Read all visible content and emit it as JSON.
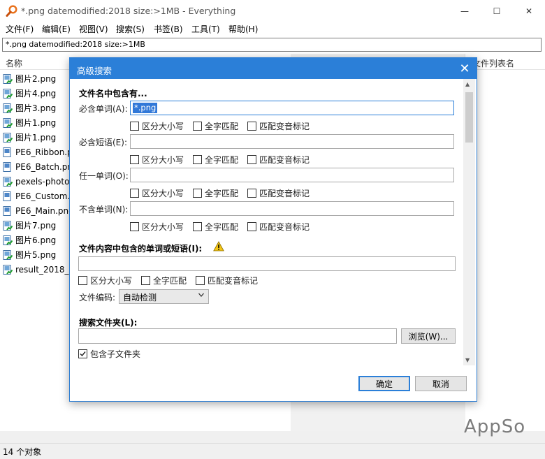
{
  "window": {
    "title": "*.png datemodified:2018 size:>1MB - Everything",
    "minimize_glyph": "—",
    "maximize_glyph": "☐",
    "close_glyph": "✕"
  },
  "menu": [
    "文件(F)",
    "编辑(E)",
    "视图(V)",
    "搜索(S)",
    "书签(B)",
    "工具(T)",
    "帮助(H)"
  ],
  "search": {
    "value": "*.png datemodified:2018 size:>1MB"
  },
  "columns": {
    "name": "名称",
    "filelist": "文件列表名"
  },
  "files": [
    {
      "name": "图片2.png",
      "icon": "png-green"
    },
    {
      "name": "图片4.png",
      "icon": "png-green"
    },
    {
      "name": "图片3.png",
      "icon": "png-green"
    },
    {
      "name": "图片1.png",
      "icon": "png-green"
    },
    {
      "name": "图片1.png",
      "icon": "png-green"
    },
    {
      "name": "PE6_Ribbon.p",
      "icon": "png-blue"
    },
    {
      "name": "PE6_Batch.pn",
      "icon": "png-blue"
    },
    {
      "name": "pexels-photo",
      "icon": "png-green"
    },
    {
      "name": "PE6_Custom.p",
      "icon": "png-blue"
    },
    {
      "name": "PE6_Main.png",
      "icon": "png-blue"
    },
    {
      "name": "图片7.png",
      "icon": "png-green"
    },
    {
      "name": "图片6.png",
      "icon": "png-green"
    },
    {
      "name": "图片5.png",
      "icon": "png-green"
    },
    {
      "name": "result_2018_0",
      "icon": "png-green"
    }
  ],
  "status": {
    "count": "14 个对象"
  },
  "watermark": "AppSo",
  "dialog": {
    "title": "高级搜索",
    "close_glyph": "✕",
    "filename_section": "文件名中包含有...",
    "must_word_label": "必含单词(A):",
    "must_word_value": "*.png",
    "must_phrase_label": "必含短语(E):",
    "any_word_label": "任一单词(O):",
    "not_word_label": "不含单词(N):",
    "match_case": "区分大小写",
    "whole_word": "全字匹配",
    "match_diacritics": "匹配变音标记",
    "content_section": "文件内容中包含的单词或短语(I):",
    "encoding_label": "文件编码:",
    "encoding_value": "自动检测",
    "folder_section": "搜索文件夹(L):",
    "browse_button": "浏览(W)...",
    "include_subfolders": "包含子文件夹",
    "include_subfolders_checked": true,
    "ok_button": "确定",
    "cancel_button": "取消"
  }
}
